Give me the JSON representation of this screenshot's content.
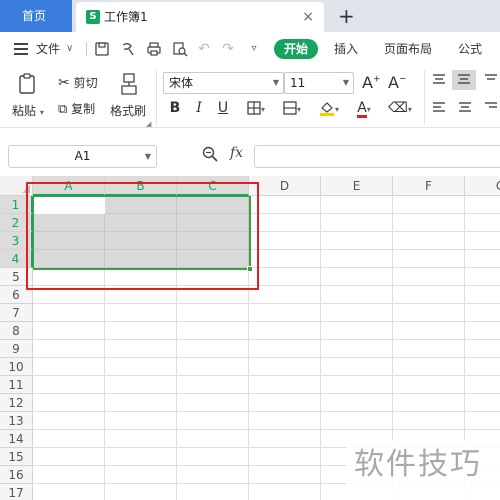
{
  "tabs": {
    "home_label": "首页",
    "doc_icon_letter": "S",
    "doc_title": "工作簿1",
    "close_glyph": "×",
    "new_tab_glyph": "+"
  },
  "menu": {
    "file_label": "文件",
    "start_tab": "开始",
    "tabs": [
      "插入",
      "页面布局",
      "公式"
    ]
  },
  "ribbon": {
    "paste_label": "粘贴",
    "cut_label": "剪切",
    "copy_label": "复制",
    "format_painter_label": "格式刷",
    "font_name": "宋体",
    "font_size": "11",
    "bold": "B",
    "italic": "I",
    "underline": "U",
    "font_color_letter": "A",
    "grow_font": "A+",
    "shrink_font": "A-",
    "font_color_accent": "#e02020",
    "fill_color_accent": "#f5d000"
  },
  "formula_bar": {
    "name_box": "A1",
    "fx_label": "fx",
    "formula_value": ""
  },
  "grid": {
    "columns": [
      "A",
      "B",
      "C",
      "D",
      "E",
      "F",
      "G"
    ],
    "rows": [
      "1",
      "2",
      "3",
      "4",
      "5",
      "6",
      "7",
      "8",
      "9",
      "10",
      "11",
      "12",
      "13",
      "14",
      "15",
      "16",
      "17"
    ],
    "active_columns": [
      "A",
      "B",
      "C"
    ],
    "active_rows": [
      "1",
      "2",
      "3",
      "4"
    ],
    "selection": "A1:C4",
    "selection_color": "#3ca046",
    "highlight_color": "#e02020"
  },
  "watermark": "软件技巧"
}
